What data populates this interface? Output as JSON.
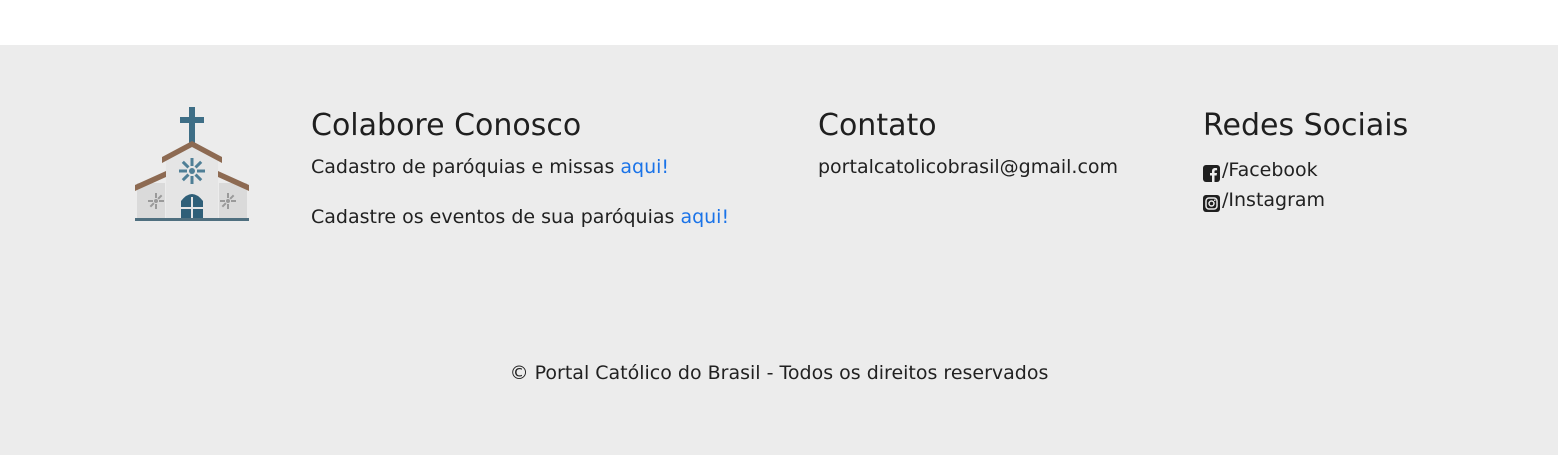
{
  "colabore": {
    "title": "Colabore Conosco",
    "line1_text": "Cadastro de paróquias e missas ",
    "line1_link": "aqui!",
    "line2_text": "Cadastre os eventos de sua paróquias ",
    "line2_link": "aqui!"
  },
  "contato": {
    "title": "Contato",
    "email": "portalcatolicobrasil@gmail.com"
  },
  "redes": {
    "title": "Redes Sociais",
    "facebook": "/Facebook",
    "instagram": "/Instagram"
  },
  "footer": {
    "copyright": "© Portal Católico do Brasil - Todos os direitos reservados"
  },
  "icons": {
    "logo": "church-icon",
    "facebook": "facebook-icon",
    "instagram": "instagram-icon"
  },
  "colors": {
    "footer_bg": "#ececec",
    "link": "#1a73e8",
    "text": "#212121"
  }
}
